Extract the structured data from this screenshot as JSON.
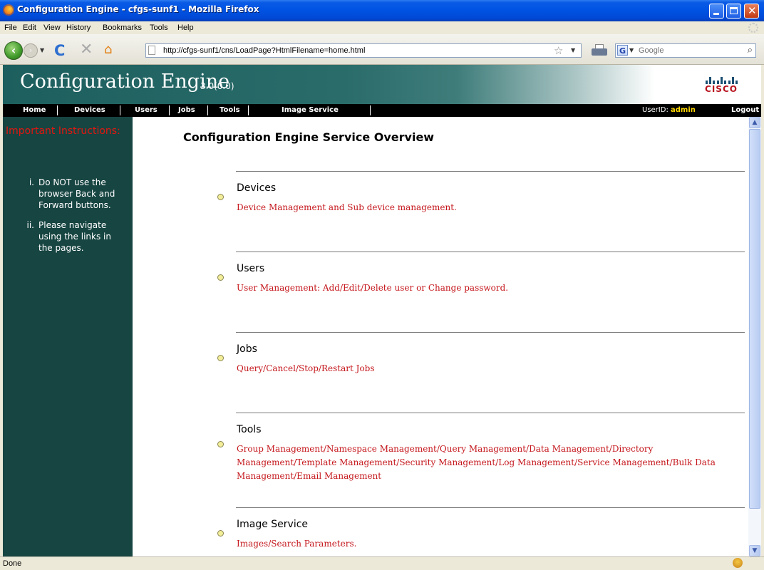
{
  "window": {
    "title": "Configuration Engine - cfgs-sunf1 - Mozilla Firefox"
  },
  "menu": [
    "File",
    "Edit",
    "View",
    "History",
    "Bookmarks",
    "Tools",
    "Help"
  ],
  "address": {
    "url": "http://cfgs-sunf1/cns/LoadPage?HtmlFilename=home.html"
  },
  "search": {
    "placeholder": "Google"
  },
  "app": {
    "title": "Configuration Engine",
    "version": "3.0(0.0)",
    "brand": "CISCO"
  },
  "nav": {
    "items": [
      "Home",
      "Devices",
      "Users",
      "Jobs",
      "Tools",
      "Image Service"
    ],
    "userid_label": "UserID:",
    "userid": "admin",
    "logout": "Logout"
  },
  "sidebar": {
    "heading": "Important Instructions:",
    "instructions": [
      {
        "num": "i.",
        "text": "Do NOT use the browser Back and Forward buttons."
      },
      {
        "num": "ii.",
        "text": "Please navigate using the links in the pages."
      }
    ]
  },
  "main": {
    "heading": "Configuration Engine Service Overview",
    "sections": [
      {
        "title": "Devices",
        "desc": "Device Management and Sub device management."
      },
      {
        "title": "Users",
        "desc": "User Management: Add/Edit/Delete user or Change password."
      },
      {
        "title": "Jobs",
        "desc": "Query/Cancel/Stop/Restart Jobs"
      },
      {
        "title": "Tools",
        "desc": "Group Management/Namespace Management/Query Management/Data Management/Directory Management/Template Management/Security Management/Log Management/Service Management/Bulk Data Management/Email Management"
      },
      {
        "title": "Image Service",
        "desc": "Images/Search Parameters."
      }
    ]
  },
  "status": {
    "text": "Done"
  },
  "colors": {
    "banner": "#1d5f5e",
    "sidebar": "#174542",
    "link": "#c4161b",
    "accent": "#e4160f"
  }
}
